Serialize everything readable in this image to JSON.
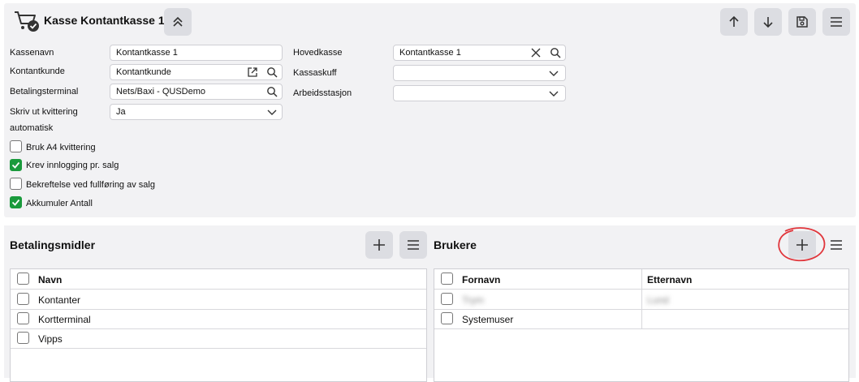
{
  "header": {
    "title": "Kasse Kontantkasse 1",
    "icon": "cash-register-cart-icon"
  },
  "form": {
    "kassenavn_label": "Kassenavn",
    "kassenavn_value": "Kontantkasse 1",
    "kontantkunde_label": "Kontantkunde",
    "kontantkunde_value": "Kontantkunde",
    "betalingsterminal_label": "Betalingsterminal",
    "betalingsterminal_value": "Nets/Baxi - QUSDemo",
    "skriv_label_line1": "Skriv ut kvittering",
    "skriv_label_line2": "automatisk",
    "skriv_value": "Ja",
    "hovedkasse_label": "Hovedkasse",
    "hovedkasse_value": "Kontantkasse 1",
    "kassaskuff_label": "Kassaskuff",
    "kassaskuff_value": "",
    "arbeidsstasjon_label": "Arbeidsstasjon",
    "arbeidsstasjon_value": ""
  },
  "checkboxes": [
    {
      "label": "Bruk A4 kvittering",
      "checked": false
    },
    {
      "label": "Krev innlogging pr. salg",
      "checked": true
    },
    {
      "label": "Bekreftelse ved fullføring av salg",
      "checked": false
    },
    {
      "label": "Akkumuler Antall",
      "checked": true
    }
  ],
  "betalingsmidler": {
    "title": "Betalingsmidler",
    "column": "Navn",
    "rows": [
      "Kontanter",
      "Kortterminal",
      "Vipps"
    ]
  },
  "brukere": {
    "title": "Brukere",
    "columns": [
      "Fornavn",
      "Etternavn"
    ],
    "rows": [
      {
        "fornavn": "Trym",
        "etternavn": "Lund",
        "blurred": true
      },
      {
        "fornavn": "Systemuser",
        "etternavn": "",
        "blurred": false
      }
    ]
  },
  "colors": {
    "accent_green": "#1a9a3c",
    "highlight_red": "#e0353b",
    "button_bg": "#dcdde2",
    "panel_bg": "#f2f2f4"
  }
}
